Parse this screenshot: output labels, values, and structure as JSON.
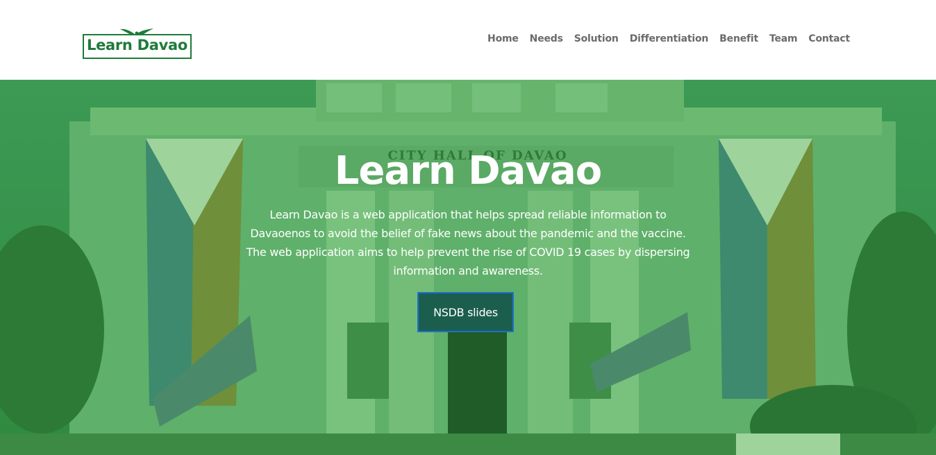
{
  "brand": {
    "logo_text": "Learn Davao",
    "color": "#1e7b3a"
  },
  "nav": {
    "items": [
      {
        "label": "Home"
      },
      {
        "label": "Needs"
      },
      {
        "label": "Solution"
      },
      {
        "label": "Differentiation"
      },
      {
        "label": "Benefit"
      },
      {
        "label": "Team"
      },
      {
        "label": "Contact"
      }
    ]
  },
  "hero": {
    "background_sign": "CITY HALL OF DAVAO",
    "title": "Learn Davao",
    "description": "Learn Davao is a web application that helps spread reliable information to Davaoenos to avoid the belief of fake news about the pandemic and the vaccine. The web application aims to help prevent the rise of COVID 19 cases by dispersing information and awareness.",
    "button_label": "NSDB slides",
    "overlay_color": "#2e8a3a"
  }
}
